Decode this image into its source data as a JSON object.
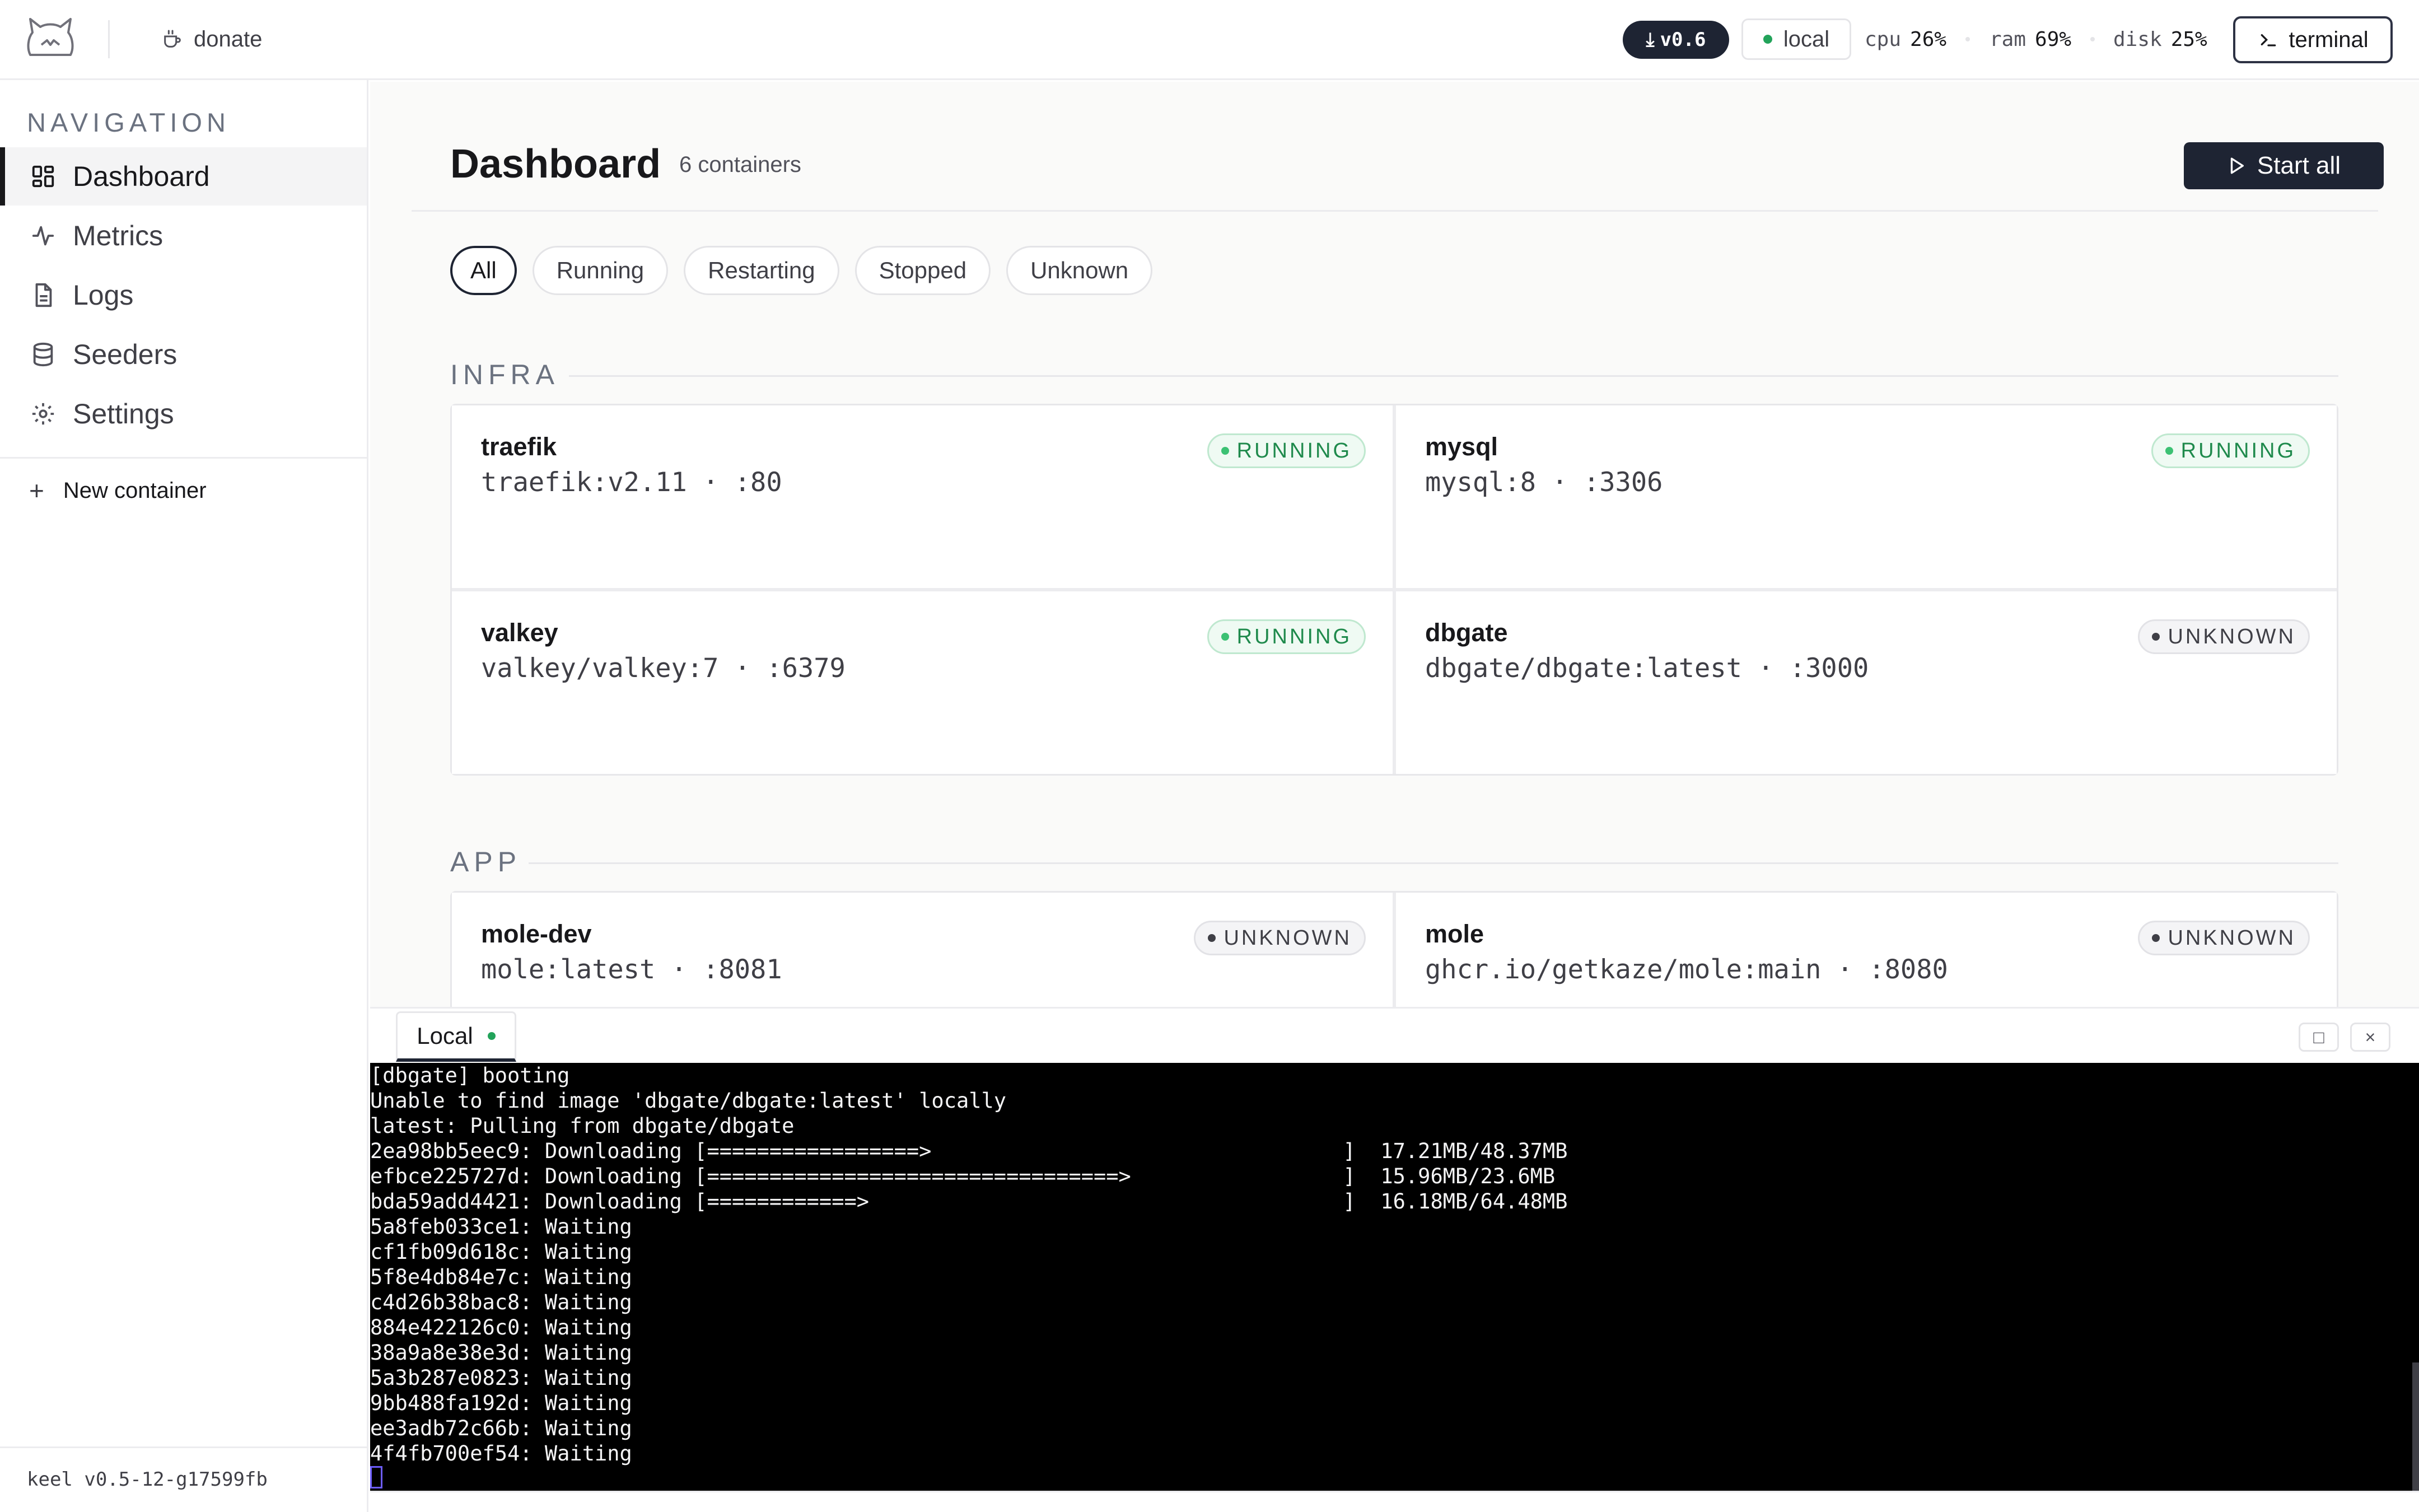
{
  "topbar": {
    "donate_label": "donate",
    "version": "v0.6",
    "context": "local",
    "stats": [
      {
        "key": "cpu",
        "value": "26%"
      },
      {
        "key": "ram",
        "value": "69%"
      },
      {
        "key": "disk",
        "value": "25%"
      }
    ],
    "terminal_label": "terminal"
  },
  "sidebar": {
    "title": "NAVIGATION",
    "items": [
      {
        "label": "Dashboard",
        "icon": "dashboard-icon",
        "active": true
      },
      {
        "label": "Metrics",
        "icon": "activity-icon"
      },
      {
        "label": "Logs",
        "icon": "file-icon"
      },
      {
        "label": "Seeders",
        "icon": "database-icon"
      },
      {
        "label": "Settings",
        "icon": "gear-icon"
      }
    ],
    "new_container": "New container",
    "footer": "keel v0.5-12-g17599fb"
  },
  "main": {
    "title": "Dashboard",
    "count": "6 containers",
    "start_all": "Start all",
    "filters": [
      "All",
      "Running",
      "Restarting",
      "Stopped",
      "Unknown"
    ],
    "active_filter": "All",
    "sections": [
      {
        "name": "INFRA",
        "containers": [
          {
            "name": "traefik",
            "image": "traefik:v2.11 · :80",
            "status": "RUNNING"
          },
          {
            "name": "mysql",
            "image": "mysql:8 · :3306",
            "status": "RUNNING"
          },
          {
            "name": "valkey",
            "image": "valkey/valkey:7 · :6379",
            "status": "RUNNING"
          },
          {
            "name": "dbgate",
            "image": "dbgate/dbgate:latest · :3000",
            "status": "UNKNOWN"
          }
        ]
      },
      {
        "name": "APP",
        "containers": [
          {
            "name": "mole-dev",
            "image": "mole:latest · :8081",
            "status": "UNKNOWN"
          },
          {
            "name": "mole",
            "image": "ghcr.io/getkaze/mole:main · :8080",
            "status": "UNKNOWN"
          }
        ]
      }
    ]
  },
  "terminal": {
    "tab": "Local",
    "lines": [
      "[dbgate] booting",
      "Unable to find image 'dbgate/dbgate:latest' locally",
      "latest: Pulling from dbgate/dbgate",
      "2ea98bb5eec9: Downloading [=================>                                 ]  17.21MB/48.37MB",
      "efbce225727d: Downloading [=================================>                 ]  15.96MB/23.6MB",
      "bda59add4421: Downloading [============>                                      ]  16.18MB/64.48MB",
      "5a8feb033ce1: Waiting",
      "cf1fb09d618c: Waiting",
      "5f8e4db84e7c: Waiting",
      "c4d26b38bac8: Waiting",
      "884e422126c0: Waiting",
      "38a9a8e38e3d: Waiting",
      "5a3b287e0823: Waiting",
      "9bb488fa192d: Waiting",
      "ee3adb72c66b: Waiting",
      "4f4fb700ef54: Waiting"
    ]
  }
}
